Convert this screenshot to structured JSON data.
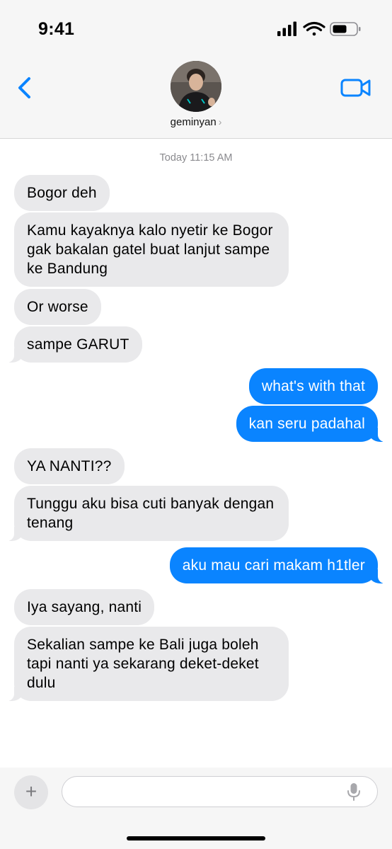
{
  "status_bar": {
    "time": "9:41"
  },
  "contact": {
    "name": "geminyan",
    "chevron": "›"
  },
  "thread": {
    "timestamp": "Today 11:15 AM"
  },
  "messages": [
    {
      "direction": "incoming",
      "text": "Bogor deh"
    },
    {
      "direction": "incoming",
      "text": "Kamu kayaknya kalo nyetir ke Bogor gak bakalan gatel buat lanjut sampe ke Bandung"
    },
    {
      "direction": "incoming",
      "text": "Or worse"
    },
    {
      "direction": "incoming",
      "text": "sampe GARUT"
    },
    {
      "direction": "outgoing",
      "text": "what's with that"
    },
    {
      "direction": "outgoing",
      "text": "kan seru padahal"
    },
    {
      "direction": "incoming",
      "text": "YA NANTI??"
    },
    {
      "direction": "incoming",
      "text": "Tunggu aku bisa cuti banyak dengan tenang"
    },
    {
      "direction": "outgoing",
      "text": "aku mau cari makam h1tler"
    },
    {
      "direction": "incoming",
      "text": "Iya sayang, nanti"
    },
    {
      "direction": "incoming",
      "text": "Sekalian sampe ke Bali juga boleh tapi nanti ya sekarang deket-deket dulu"
    }
  ],
  "composer": {
    "plus_label": "+",
    "placeholder": ""
  },
  "icons": {
    "back": "chevron-left-icon",
    "video": "video-camera-icon",
    "mic": "microphone-icon",
    "signal": "cellular-signal-icon",
    "wifi": "wifi-icon",
    "battery": "battery-icon"
  },
  "colors": {
    "accent": "#0a84ff",
    "incoming_bubble": "#e9e9eb",
    "header_bg": "#f6f6f6"
  }
}
